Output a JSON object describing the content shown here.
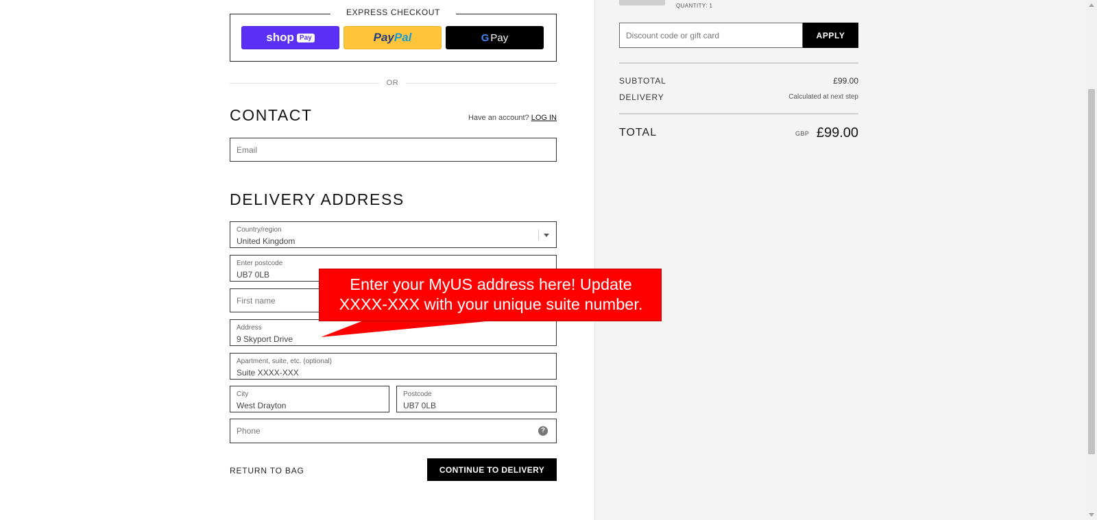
{
  "express_checkout": {
    "title": "EXPRESS CHECKOUT",
    "shop_pay": {
      "shop": "shop",
      "pay": "Pay",
      "color": "#5a31f4"
    },
    "paypal": {
      "part1": "Pay",
      "part2": "Pal",
      "color": "#ffc439"
    },
    "google_pay": {
      "g": "G",
      "pay": "Pay",
      "color": "#000000"
    },
    "or_label": "OR"
  },
  "contact": {
    "title": "CONTACT",
    "have_account": "Have an account?",
    "login_label": "LOG IN",
    "email_placeholder": "Email"
  },
  "delivery_address": {
    "title": "DELIVERY ADDRESS",
    "country": {
      "label": "Country/region",
      "value": "United Kingdom"
    },
    "postcode_lookup": {
      "label": "Enter postcode",
      "value": "UB7 0LB"
    },
    "first_name": {
      "placeholder": "First name"
    },
    "address": {
      "label": "Address",
      "value": "9 Skyport Drive"
    },
    "apartment": {
      "label": "Apartment, suite, etc. (optional)",
      "value": "Suite XXXX-XXX"
    },
    "city": {
      "label": "City",
      "value": "West Drayton"
    },
    "postcode": {
      "label": "Postcode",
      "value": "UB7 0LB"
    },
    "phone": {
      "placeholder": "Phone",
      "help_icon": "question-mark-icon"
    }
  },
  "footer": {
    "return_label": "RETURN TO BAG",
    "continue_label": "CONTINUE TO DELIVERY"
  },
  "callout": {
    "line1": "Enter your MyUS address here! Update",
    "line2": "XXXX-XXX with your unique suite number.",
    "color": "#ff0000"
  },
  "order_summary": {
    "quantity": "QUANTITY: 1",
    "discount_placeholder": "Discount code or gift card",
    "apply_label": "APPLY",
    "subtotal_label": "SUBTOTAL",
    "subtotal_value": "£99.00",
    "delivery_label": "DELIVERY",
    "delivery_value": "Calculated at next step",
    "total_label": "TOTAL",
    "total_currency": "GBP",
    "total_value": "£99.00"
  }
}
